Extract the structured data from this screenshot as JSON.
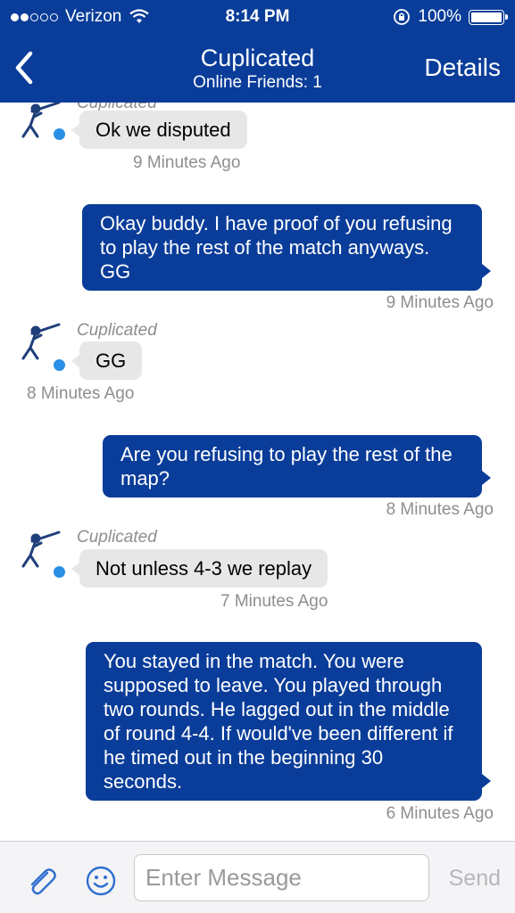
{
  "status_bar": {
    "carrier": "Verizon",
    "time": "8:14 PM",
    "battery": "100%"
  },
  "nav": {
    "title": "Cuplicated",
    "subtitle": "Online Friends: 1",
    "details_label": "Details"
  },
  "messages": [
    {
      "direction": "incoming",
      "sender": "Cuplicated",
      "text": "Ok we disputed",
      "time": "9 Minutes Ago"
    },
    {
      "direction": "outgoing",
      "text": "Okay buddy. I have proof of you refusing to play the rest of the match anyways. GG",
      "time": "9 Minutes Ago"
    },
    {
      "direction": "incoming",
      "sender": "Cuplicated",
      "text": "GG",
      "time": "8 Minutes Ago"
    },
    {
      "direction": "outgoing",
      "text": "Are you refusing to play the rest of the map?",
      "time": "8 Minutes Ago"
    },
    {
      "direction": "incoming",
      "sender": "Cuplicated",
      "text": "Not unless 4-3 we replay",
      "time": "7 Minutes Ago"
    },
    {
      "direction": "outgoing",
      "text": "You stayed in the match. You were supposed to leave. You played through two rounds. He lagged out in the middle of round 4-4. If would've been different if he timed out in the beginning 30 seconds.",
      "time": "6 Minutes Ago"
    }
  ],
  "composer": {
    "placeholder": "Enter Message",
    "send_label": "Send"
  },
  "colors": {
    "brand": "#0a3d99",
    "incoming_bubble": "#e7e7e7",
    "online_dot": "#2a8fe6"
  },
  "icons": [
    "back-chevron-icon",
    "wifi-icon",
    "orientation-lock-icon",
    "battery-icon",
    "paperclip-icon",
    "smiley-icon",
    "batter-avatar-icon"
  ]
}
